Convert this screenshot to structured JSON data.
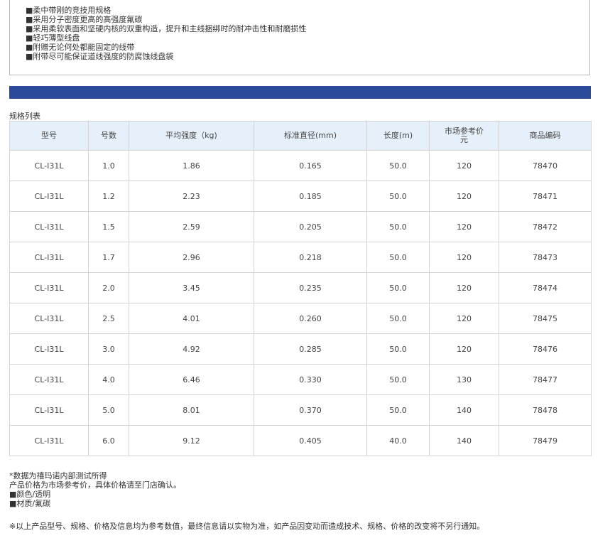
{
  "features": [
    "■柔中带刚的竞技用规格",
    "■采用分子密度更高的高强度氟碳",
    "■采用柔软表面和坚硬内核的双重构造，提升和主线捆绑时的耐冲击性和耐磨损性",
    "■轻巧薄型线盘",
    "■附赠无论何处都能固定的线带",
    "■附带尽可能保证道线强度的防腐蚀线盘袋"
  ],
  "table_caption": "规格列表",
  "columns": [
    "型号",
    "号数",
    "平均强度（kg)",
    "标准直径(mm)",
    "长度(m)",
    "市场参考价\n元",
    "商品编码"
  ],
  "rows": [
    [
      "CL-I31L",
      "1.0",
      "1.86",
      "0.165",
      "50.0",
      "120",
      "78470"
    ],
    [
      "CL-I31L",
      "1.2",
      "2.23",
      "0.185",
      "50.0",
      "120",
      "78471"
    ],
    [
      "CL-I31L",
      "1.5",
      "2.59",
      "0.205",
      "50.0",
      "120",
      "78472"
    ],
    [
      "CL-I31L",
      "1.7",
      "2.96",
      "0.218",
      "50.0",
      "120",
      "78473"
    ],
    [
      "CL-I31L",
      "2.0",
      "3.45",
      "0.235",
      "50.0",
      "120",
      "78474"
    ],
    [
      "CL-I31L",
      "2.5",
      "4.01",
      "0.260",
      "50.0",
      "120",
      "78475"
    ],
    [
      "CL-I31L",
      "3.0",
      "4.92",
      "0.285",
      "50.0",
      "120",
      "78476"
    ],
    [
      "CL-I31L",
      "4.0",
      "6.46",
      "0.330",
      "50.0",
      "130",
      "78477"
    ],
    [
      "CL-I31L",
      "5.0",
      "8.01",
      "0.370",
      "50.0",
      "140",
      "78478"
    ],
    [
      "CL-I31L",
      "6.0",
      "9.12",
      "0.405",
      "40.0",
      "140",
      "78479"
    ]
  ],
  "notes": [
    "*数据为禧玛诺内部测试所得",
    "产品价格为市场参考价，具体价格请至门店确认。",
    "■颜色/透明",
    "■材质/氟碳"
  ],
  "disclaimer": "※以上产品型号、规格、价格及信息均为参考数值，最终信息请以实物为准，如产品因变动而造成技术、规格、价格的改变将不另行通知。",
  "colors": {
    "bar": "#2b4a9b",
    "header_bg": "#e6f0fb",
    "border": "#d4d4d4"
  }
}
